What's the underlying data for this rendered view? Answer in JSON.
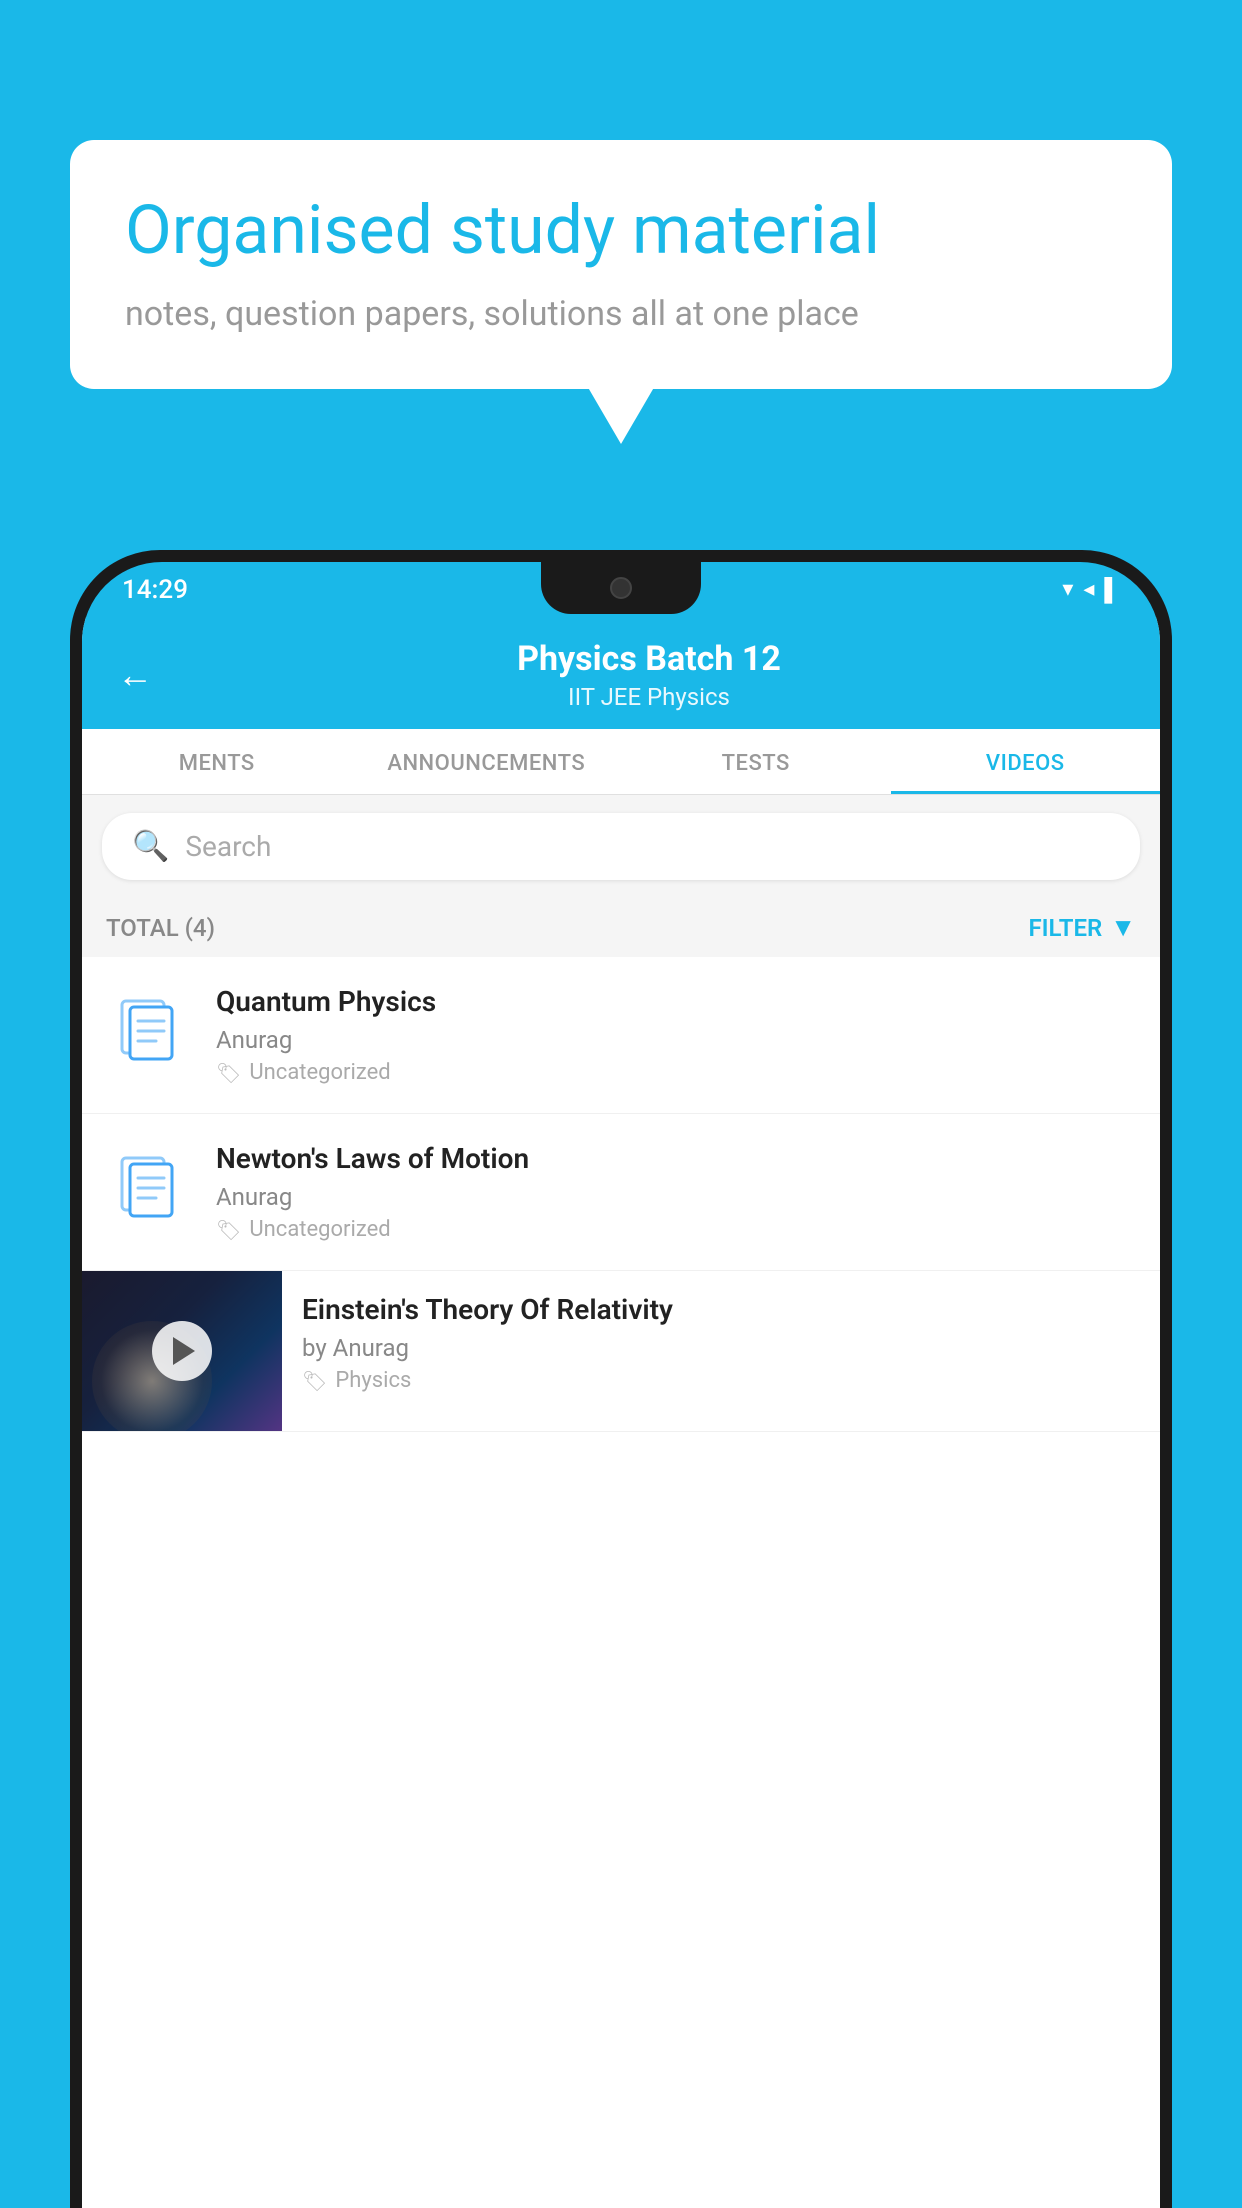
{
  "background_color": "#1ab8e8",
  "bubble": {
    "title": "Organised study material",
    "subtitle": "notes, question papers, solutions all at one place"
  },
  "phone": {
    "status_bar": {
      "time": "14:29",
      "icons": [
        "wifi",
        "signal",
        "battery"
      ]
    },
    "header": {
      "back_label": "←",
      "title": "Physics Batch 12",
      "subtitle": "IIT JEE   Physics"
    },
    "tabs": [
      {
        "label": "MENTS",
        "active": false
      },
      {
        "label": "ANNOUNCEMENTS",
        "active": false
      },
      {
        "label": "TESTS",
        "active": false
      },
      {
        "label": "VIDEOS",
        "active": true
      }
    ],
    "search": {
      "placeholder": "Search"
    },
    "filter": {
      "total_label": "TOTAL (4)",
      "filter_label": "FILTER"
    },
    "videos": [
      {
        "id": 1,
        "title": "Quantum Physics",
        "author": "Anurag",
        "tag": "Uncategorized",
        "has_thumbnail": false
      },
      {
        "id": 2,
        "title": "Newton's Laws of Motion",
        "author": "Anurag",
        "tag": "Uncategorized",
        "has_thumbnail": false
      },
      {
        "id": 3,
        "title": "Einstein's Theory Of Relativity",
        "author": "by Anurag",
        "tag": "Physics",
        "has_thumbnail": true
      }
    ]
  }
}
